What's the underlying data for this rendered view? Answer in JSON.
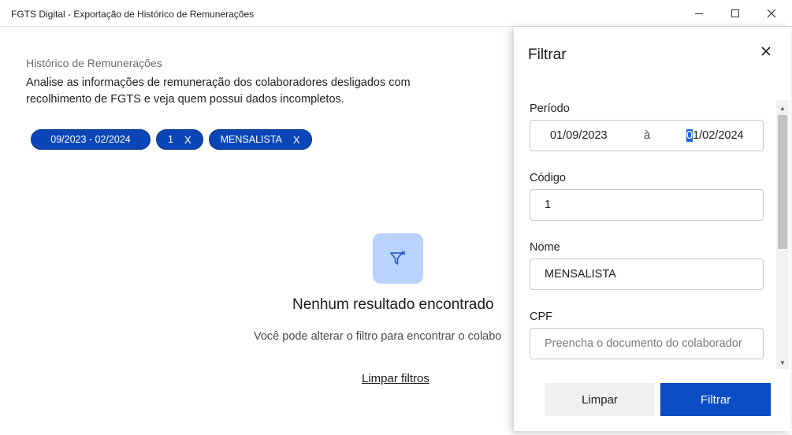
{
  "window": {
    "title": "FGTS Digital - Exportação de Histórico de Remunerações"
  },
  "page": {
    "kicker": "Histórico de Remunerações",
    "description": "Analise as informações de remuneração dos colaboradores desligados com recolhimento de FGTS e veja quem possui dados incompletos.",
    "chips": [
      {
        "label": "09/2023 - 02/2024"
      },
      {
        "label": "1",
        "remove": "X"
      },
      {
        "label": "MENSALISTA",
        "remove": "X"
      }
    ],
    "empty_state": {
      "icon": "filter-x-icon",
      "title": "Nenhum resultado encontrado",
      "subtitle": "Você pode alterar o filtro para encontrar o colabo",
      "clear_link": "Limpar filtros"
    }
  },
  "filter_panel": {
    "title": "Filtrar",
    "periodo": {
      "label": "Período",
      "start": "01/09/2023",
      "separator": "à",
      "end_selected": "0",
      "end_rest": "1/02/2024"
    },
    "codigo": {
      "label": "Código",
      "value": "1"
    },
    "nome": {
      "label": "Nome",
      "value": "MENSALISTA"
    },
    "cpf": {
      "label": "CPF",
      "value": "",
      "placeholder": "Preencha o documento do colaborador"
    },
    "buttons": {
      "clear": "Limpar",
      "apply": "Filtrar"
    }
  },
  "colors": {
    "chip_bg": "#0a46b8",
    "primary_button": "#0a4cc2",
    "empty_icon_bg": "#b8d3ff"
  }
}
